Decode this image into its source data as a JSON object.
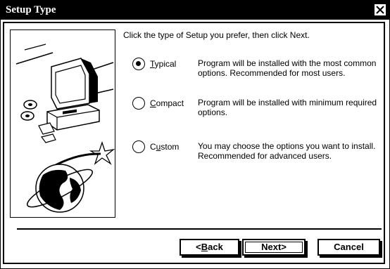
{
  "window": {
    "title": "Setup Type"
  },
  "intro": "Click the type of Setup you prefer, then click Next.",
  "options": [
    {
      "label_first": "T",
      "label_rest": "ypical",
      "selected": true,
      "description_1": "Program will be installed with the most common",
      "description_2": "options. Recommended for most users."
    },
    {
      "label_first": "C",
      "label_rest": "ompact",
      "selected": false,
      "description_1": "Program will be installed with minimum required",
      "description_2": "options."
    },
    {
      "label_first": "C",
      "label_rest": "ustom",
      "selected": false,
      "underline_second": "u",
      "description_1": "You may choose the options you want to install.",
      "description_2": "Recommended for advanced users."
    }
  ],
  "buttons": {
    "back_prefix": "<",
    "back_hot": "B",
    "back_rest": "ack",
    "next": "Next>",
    "cancel": "Cancel"
  },
  "icons": {
    "close": "close-icon",
    "illustration": "computer-globe-illustration"
  }
}
